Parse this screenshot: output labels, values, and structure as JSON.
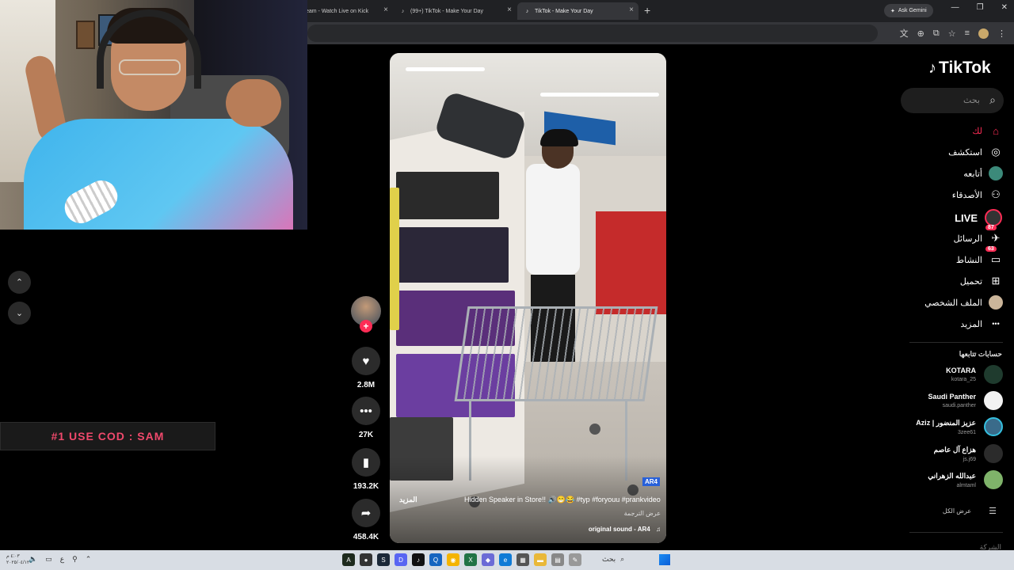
{
  "browser": {
    "tabs": [
      {
        "label": "eam - Watch Live on Kick",
        "active": false
      },
      {
        "label": "(99+) TikTok - Make Your Day",
        "active": false
      },
      {
        "label": "TikTok - Make Your Day",
        "active": true
      }
    ],
    "new_tab": "+",
    "gemini_label": "Ask Gemini",
    "window_controls": [
      "—",
      "❐",
      "✕"
    ]
  },
  "stream_overlay": {
    "promo_text": "#1 USE COD : SAM",
    "nav_up": "⌃",
    "nav_down": "⌄"
  },
  "video": {
    "caption": "Hidden Speaker in Store!! 🔊😁😂 #typ #foryouu #prankvideo ...",
    "more_label": "المزيد",
    "translate_label": "عرض الترجمة",
    "sound_label": "original sound - AR4",
    "watermark": "AR4"
  },
  "actions": {
    "likes": "2.8M",
    "comments": "27K",
    "saves": "193.2K",
    "shares": "458.4K"
  },
  "sidebar": {
    "logo": "TikTok",
    "search_placeholder": "بحث",
    "nav": [
      {
        "label": "لك",
        "icon": "home-icon",
        "glyph": "⌂"
      },
      {
        "label": "استكشف",
        "icon": "compass-icon",
        "glyph": "◎"
      },
      {
        "label": "أتابعه",
        "icon": "avatar-icon",
        "glyph": ""
      },
      {
        "label": "الأصدقاء",
        "icon": "friends-icon",
        "glyph": "👥"
      },
      {
        "label": "LIVE",
        "icon": "live-icon",
        "glyph": ""
      },
      {
        "label": "الرسائل",
        "icon": "messages-icon",
        "glyph": "✈",
        "badge": "87"
      },
      {
        "label": "النشاط",
        "icon": "activity-icon",
        "glyph": "▭",
        "badge": "63"
      },
      {
        "label": "تحميل",
        "icon": "upload-icon",
        "glyph": "⊞"
      },
      {
        "label": "الملف الشخصي",
        "icon": "profile-icon",
        "glyph": ""
      },
      {
        "label": "المزيد",
        "icon": "more-icon",
        "glyph": "•••"
      }
    ],
    "following_title": "حسابات تتابعها",
    "accounts": [
      {
        "name": "KOTARA",
        "username": "kotara_25",
        "color": "#1f3b2e"
      },
      {
        "name": "Saudi Panther",
        "username": "saudi.panther",
        "color": "#f2f2f2"
      },
      {
        "name": "Aziz | عزيز المنضور",
        "username": "3zee61",
        "color": "#3a6b8a"
      },
      {
        "name": "هزاع آل عاصم",
        "username": "js.j69",
        "color": "#2b2b2b"
      },
      {
        "name": "عبدالله الزهراني",
        "username": "almtaml",
        "color": "#7fb36a"
      }
    ],
    "see_all": "عرض الكل",
    "footer_cut": "الشركة"
  },
  "taskbar": {
    "clock_time": "٤:٠٣ م",
    "clock_date": "٢٠٢٥/٠٤/١٢",
    "search_label": "بحث"
  },
  "colors": {
    "brand": "#fe2c55",
    "background": "#000000"
  }
}
